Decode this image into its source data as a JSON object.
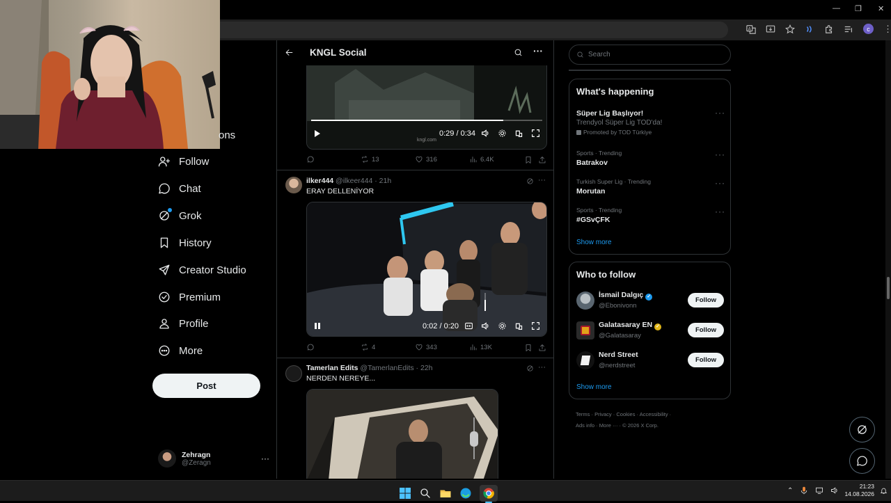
{
  "window": {
    "minimize_glyph": "—",
    "maximize_glyph": "❐",
    "close_glyph": "✕",
    "profile_initial": "c"
  },
  "nav": {
    "partial_item": "ons",
    "items": [
      {
        "label": "Follow",
        "icon": "person-plus-icon"
      },
      {
        "label": "Chat",
        "icon": "chat-bubble-icon"
      },
      {
        "label": "Grok",
        "icon": "grok-icon"
      },
      {
        "label": "History",
        "icon": "bookmark-icon"
      },
      {
        "label": "Creator Studio",
        "icon": "rocket-icon"
      },
      {
        "label": "Premium",
        "icon": "verified-icon"
      },
      {
        "label": "Profile",
        "icon": "person-icon"
      },
      {
        "label": "More",
        "icon": "more-circle-icon"
      }
    ],
    "post_label": "Post",
    "account": {
      "name": "Zehragn",
      "handle": "@Zeragn",
      "menu": "···"
    }
  },
  "header": {
    "title": "KNGL Social"
  },
  "tweets": [
    {
      "video": {
        "time": "0:29 / 0:34",
        "progress": 0.83,
        "watermark": "kngl.com"
      },
      "actions": {
        "replies": "",
        "reposts": "13",
        "likes": "316",
        "views": "6.4K"
      }
    },
    {
      "author": "ilker444",
      "handle": "@ilkeer444",
      "time": "21h",
      "text": "ERAY DELLENİYOR",
      "video": {
        "time": "0:02 / 0:20",
        "volume": 0.6
      },
      "actions": {
        "replies": "",
        "reposts": "4",
        "likes": "343",
        "views": "13K"
      }
    },
    {
      "author": "Tamerlan Edits",
      "handle": "@TamerlanEdits",
      "time": "22h",
      "text": "NERDEN NEREYE..."
    }
  ],
  "search": {
    "placeholder": "Search"
  },
  "happening": {
    "title": "What's happening",
    "promoted": {
      "name": "Süper Lig Başlıyor!",
      "sub": "Trendyol Süper Lig TOD'da!",
      "promo": "Promoted by TOD Türkiye"
    },
    "trends": [
      {
        "meta": "Sports · Trending",
        "name": "Batrakov"
      },
      {
        "meta": "Turkish Super Lig · Trending",
        "name": "Morutan"
      },
      {
        "meta": "Sports · Trending",
        "name": "#GSvÇFK"
      }
    ],
    "show_more": "Show more"
  },
  "who_to_follow": {
    "title": "Who to follow",
    "users": [
      {
        "name": "İsmail Dalgıç",
        "handle": "@Ebonivonn",
        "badge_color": "#1d9bf0",
        "button": "Follow"
      },
      {
        "name": "Galatasaray EN",
        "handle": "@Galatasaray",
        "badge_color": "#e2b719",
        "button": "Follow"
      },
      {
        "name": "Nerd Street",
        "handle": "@nerdstreet",
        "badge_color": "",
        "button": "Follow"
      }
    ],
    "show_more": "Show more"
  },
  "footer": {
    "line1": [
      "Terms",
      "Privacy",
      "Cookies",
      "Accessibility"
    ],
    "line2": [
      "Ads info",
      "More ···",
      "© 2026 X Corp."
    ]
  },
  "taskbar": {
    "time": "21:23",
    "date": "14.08.2026"
  },
  "colors": {
    "accent": "#1d9bf0",
    "bg": "#000000",
    "border": "#2f3336",
    "muted": "#71767b"
  }
}
